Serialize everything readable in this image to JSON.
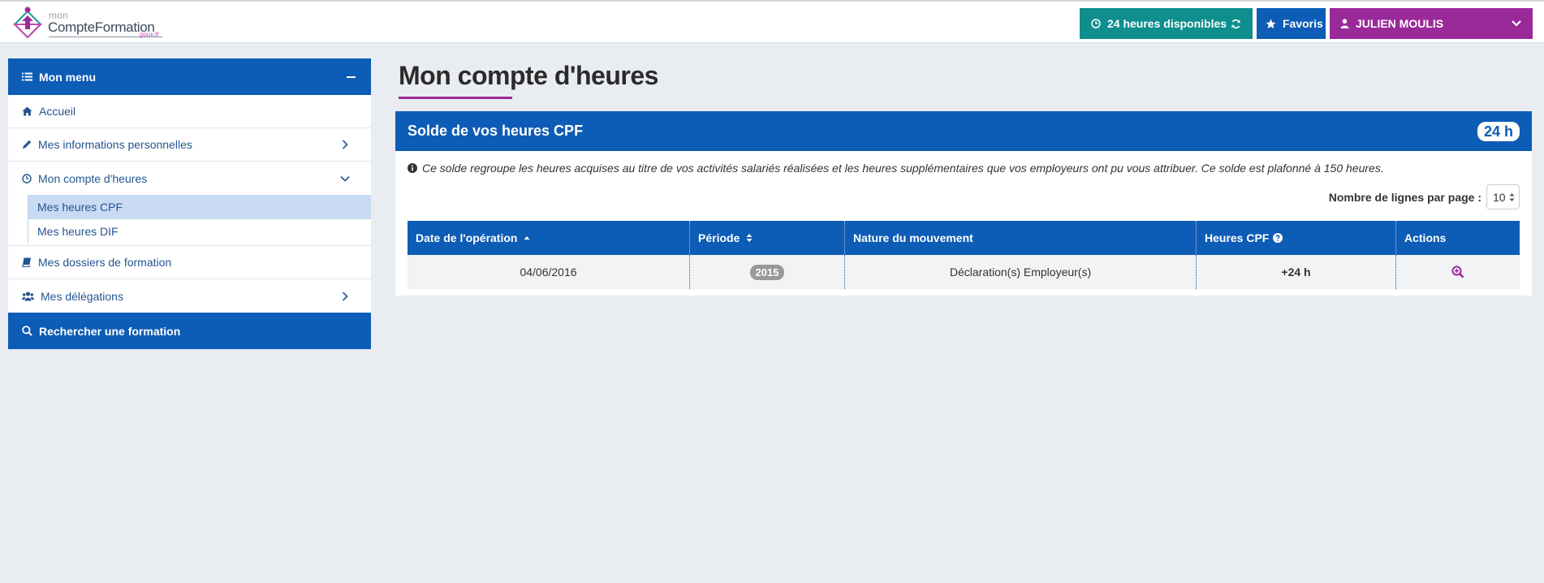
{
  "header": {
    "logo": {
      "small": "mon",
      "main": "CompteFormation",
      "suffix": "gouv.fr"
    },
    "hours_button_label": "24 heures disponibles",
    "favorites_label": "Favoris",
    "user_name": "JULIEN MOULIS",
    "colors": {
      "hours": "#0f8e8e",
      "favorites": "#0d5cb5",
      "user": "#9a2a9a"
    }
  },
  "sidebar": {
    "menu_title": "Mon menu",
    "items": [
      {
        "label": "Accueil",
        "icon": "home-icon"
      },
      {
        "label": "Mes informations personnelles",
        "icon": "pencil-icon",
        "chevron": "right"
      },
      {
        "label": "Mon compte d'heures",
        "icon": "clock-icon",
        "chevron": "down",
        "expanded": true,
        "children": [
          {
            "label": "Mes heures CPF",
            "active": true
          },
          {
            "label": "Mes heures DIF",
            "active": false
          }
        ]
      },
      {
        "label": "Mes dossiers de formation",
        "icon": "book-icon"
      },
      {
        "label": "Mes délégations",
        "icon": "users-icon",
        "chevron": "right"
      }
    ],
    "search_label": "Rechercher une formation"
  },
  "main": {
    "title": "Mon compte d'heures",
    "card": {
      "title": "Solde de vos heures CPF",
      "badge": "24 h",
      "info": "Ce solde regroupe les heures acquises au titre de vos activités salariés réalisées et les heures supplémentaires que vos employeurs ont pu vous attribuer. Ce solde est plafonné à 150 heures.",
      "rows_per_page_label": "Nombre de lignes par page :",
      "rows_per_page_value": "10"
    },
    "table": {
      "columns": [
        "Date de l'opération",
        "Période",
        "Nature du mouvement",
        "Heures CPF",
        "Actions"
      ],
      "rows": [
        {
          "date": "04/06/2016",
          "period": "2015",
          "nature": "Déclaration(s) Employeur(s)",
          "hours": "+24 h",
          "action_icon": "zoom-in-icon"
        }
      ]
    }
  }
}
